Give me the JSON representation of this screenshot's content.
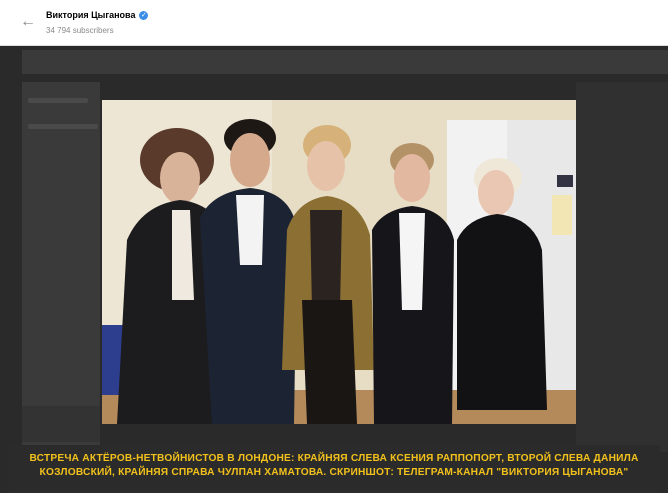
{
  "header": {
    "channel_name": "Виктория Цыганова",
    "subscribers": "34 794 subscribers"
  },
  "caption": {
    "line1": "ВСТРЕЧА АКТЁРОВ-НЕТВОЙНИСТОВ В ЛОНДОНЕ: КРАЙНЯЯ СЛЕВА КСЕНИЯ РАППОПОРТ, ВТОРОЙ СЛЕВА ДАНИЛА",
    "line2": "КОЗЛОВСКИЙ, КРАЙНЯЯ СПРАВА ЧУЛПАН ХАМАТОВА. СКРИНШОТ: ТЕЛЕГРАМ-КАНАЛ \"ВИКТОРИЯ ЦЫГАНОВА\""
  },
  "colors": {
    "caption_text": "#f2c11c",
    "verified_badge": "#3a8ee6"
  },
  "icons": [
    "back-arrow-icon",
    "verified-icon",
    "more-icon"
  ]
}
